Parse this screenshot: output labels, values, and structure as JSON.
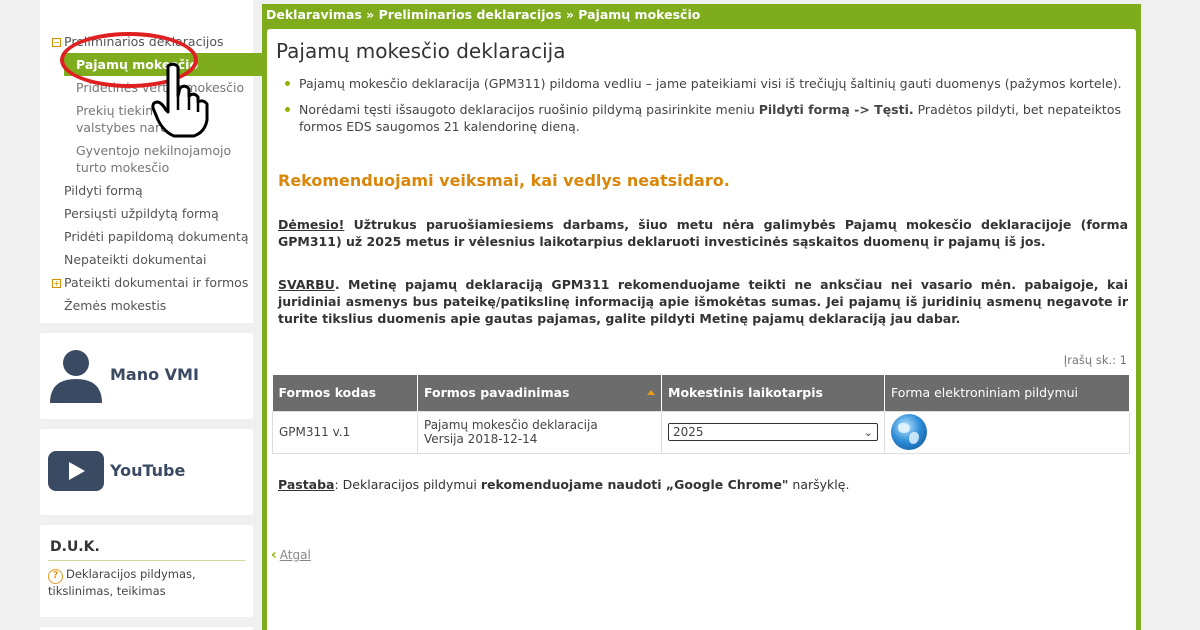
{
  "sidebar": {
    "menu": [
      {
        "label": "Preliminarios deklaracijos",
        "type": "group"
      },
      {
        "label": "Pajamų mokesčio",
        "type": "active"
      },
      {
        "label": "Pridėtinės vertės mokesčio",
        "type": "sub"
      },
      {
        "label": "Prekių tiekimo už ES valstybes narės",
        "type": "sub"
      },
      {
        "label": "Gyventojo nekilnojamojo turto mokesčio",
        "type": "sub"
      },
      {
        "label": "Pildyti formą",
        "type": "item"
      },
      {
        "label": "Persiųsti užpildytą formą",
        "type": "item"
      },
      {
        "label": "Pridėti papildomą dokumentą",
        "type": "item"
      },
      {
        "label": "Nepateikti dokumentai",
        "type": "item"
      },
      {
        "label": "Pateikti dokumentai ir formos",
        "type": "group"
      },
      {
        "label": "Žemės mokestis",
        "type": "item"
      }
    ],
    "mano_vmi": "Mano VMI",
    "youtube": "YouTube",
    "duk": {
      "title": "D.U.K.",
      "item": "Deklaracijos pildymas, tikslinimas, teikimas"
    }
  },
  "breadcrumb": "Deklaravimas » Preliminarios deklaracijos » Pajamų mokesčio",
  "main": {
    "title": "Pajamų mokesčio deklaracija",
    "bullet1": "Pajamų mokesčio deklaracija (GPM311) pildoma vedliu – jame pateikiami visi iš trečiųjų šaltinių gauti duomenys (pažymos kortele).",
    "bullet2_pre": "Norėdami tęsti išsaugoto deklaracijos ruošinio pildymą pasirinkite meniu ",
    "bullet2_bold": "Pildyti formą -> Tęsti.",
    "bullet2_post": " Pradėtos pildyti, bet nepateiktos formos EDS saugomos 21 kalendorinę dieną.",
    "recommend": "Rekomenduojami veiksmai, kai vedlys neatsidaro.",
    "p1_u": "Dėmesio!",
    "p1": " Užtrukus paruošiamiesiems darbams, šiuo metu nėra galimybės Pajamų mokesčio deklaracijoje (forma GPM311) už 2025 metus ir vėlesnius laikotarpius deklaruoti investicinės sąskaitos duomenų ir pajamų iš jos.",
    "p2_u": "SVARBU",
    "p2": ". Metinę pajamų deklaraciją GPM311 rekomenduojame teikti ne anksčiau nei vasario mėn. pabaigoje, kai juridiniai asmenys bus pateikę/patikslinę informaciją apie išmokėtas sumas. Jei pajamų iš juridinių asmenų negavote ir turite tikslius duomenis apie gautas pajamas, galite pildyti Metinę pajamų deklaraciją jau dabar.",
    "records": "Įrašų sk.: 1",
    "table": {
      "headers": [
        "Formos kodas",
        "Formos pavadinimas",
        "Mokestinis laikotarpis",
        "Forma elektroniniam pildymui"
      ],
      "row": {
        "code": "GPM311 v.1",
        "name": "Pajamų mokesčio deklaracija",
        "version": "Versija 2018-12-14",
        "period": "2025"
      }
    },
    "note_u": "Pastaba",
    "note_mid": ": Deklaracijos pildymui ",
    "note_bold": "rekomenduojame naudoti „Google Chrome\"",
    "note_end": " naršyklę.",
    "back": "Atgal"
  },
  "colors": {
    "accent_green": "#7fac1c",
    "orange": "#d9870a",
    "ring_red": "#e02020"
  }
}
